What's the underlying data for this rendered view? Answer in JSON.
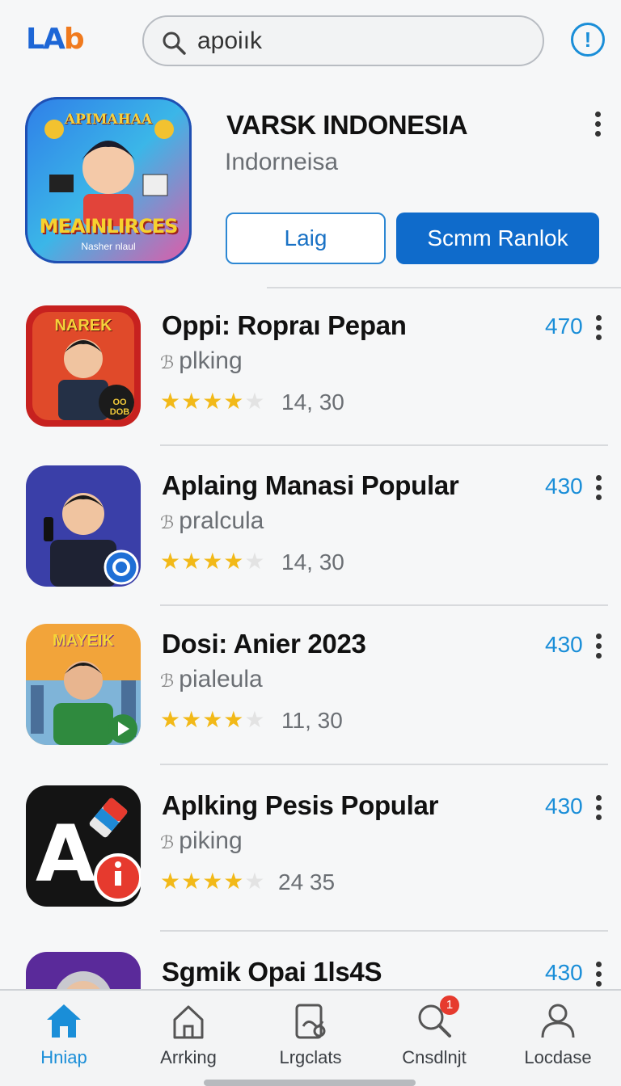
{
  "header": {
    "logo_part1": "LA",
    "logo_part2": "b",
    "search_value": "apoiık",
    "info_symbol": "!"
  },
  "featured": {
    "icon_line1": "APIMAHAA",
    "icon_line2": "MEAINLIRCES",
    "icon_line3": "Nasher nlaul",
    "title": "VARSK INDONESIA",
    "subtitle": "Indorneisa",
    "button_outline": "Laig",
    "button_primary": "Scmm Ranlok"
  },
  "apps": [
    {
      "name": "Oppi: Ropraı Pepan",
      "dev": "plking",
      "stars": 4,
      "rating": "14, 30",
      "count": "470",
      "icon_text": "NAREK",
      "icon_badge": "OO DOB"
    },
    {
      "name": "Aplaing Manasi Popular",
      "dev": "pralcula",
      "stars": 4,
      "rating": "14, 30",
      "count": "430",
      "icon_text": "",
      "icon_badge": ""
    },
    {
      "name": "Dosi: Anier 2023",
      "dev": "pialeula",
      "stars": 4,
      "rating": "11, 30",
      "count": "430",
      "icon_text": "MAYEIK",
      "icon_badge": ""
    },
    {
      "name": "Aplking Pesis Popular",
      "dev": "piking",
      "stars": 4,
      "rating": "24 35",
      "count": "430",
      "icon_text": "A",
      "icon_badge": ""
    },
    {
      "name": "Sgmik Opai 1ls4S",
      "dev": "",
      "stars": 0,
      "rating": "",
      "count": "430",
      "icon_text": "",
      "icon_badge": ""
    }
  ],
  "nav": [
    {
      "label": "Hniap",
      "active": true
    },
    {
      "label": "Arrking",
      "active": false
    },
    {
      "label": "Lrgclats",
      "active": false
    },
    {
      "label": "Cnsdlnjt",
      "active": false,
      "badge": "1"
    },
    {
      "label": "Locdase",
      "active": false
    }
  ],
  "colors": {
    "accent": "#1a8ed8",
    "primary_button": "#0f6bcb",
    "star": "#f2b918",
    "badge": "#e63a2e"
  }
}
